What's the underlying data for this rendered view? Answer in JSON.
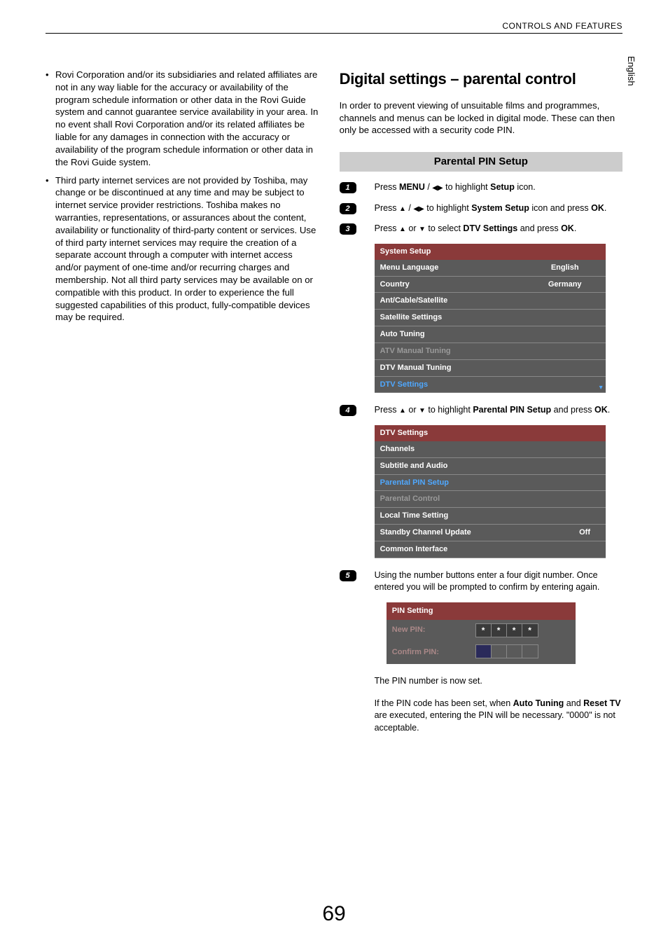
{
  "header": {
    "section": "CONTROLS AND FEATURES"
  },
  "sideTab": "English",
  "left": {
    "bullets": [
      "Rovi Corporation and/or its subsidiaries and related affiliates are not in any way liable for the accuracy or availability of the program schedule information or other data in the Rovi Guide system and cannot guarantee service availability in your area. In no event shall Rovi Corporation and/or its related affiliates be liable for any damages in connection with the accuracy or availability of the program schedule information or other data in the Rovi Guide system.",
      "Third party internet services are not provided by Toshiba, may change or be discontinued at any time and may be subject to internet service provider restrictions. Toshiba makes no warranties, representations, or assurances about the content, availability or functionality of third-party content or services. Use of third party internet services may require the creation of a separate account through a computer with internet access and/or payment of one-time and/or recurring charges and membership. Not all third party services may be available on or compatible with this product. In order to experience the full suggested capabilities of this product, fully-compatible devices may be required."
    ]
  },
  "right": {
    "title": "Digital settings – parental control",
    "intro": "In order to prevent viewing of unsuitable films and programmes, channels and menus can be locked in digital mode. These can then only be accessed with a security code PIN.",
    "subheading": "Parental PIN Setup",
    "steps": {
      "s1": {
        "n": "1",
        "a": "Press ",
        "b": "MENU",
        "c": " / ",
        "d": " to highlight ",
        "e": "Setup",
        "f": " icon."
      },
      "s2": {
        "n": "2",
        "a": "Press ",
        "b": " / ",
        "c": " to highlight ",
        "d": "System Setup",
        "e": " icon and press ",
        "f": "OK",
        "g": "."
      },
      "s3": {
        "n": "3",
        "a": "Press ",
        "b": " or ",
        "c": " to select ",
        "d": "DTV Settings",
        "e": " and press ",
        "f": "OK",
        "g": "."
      },
      "s4": {
        "n": "4",
        "a": "Press ",
        "b": " or ",
        "c": " to highlight ",
        "d": "Parental PIN Setup",
        "e": " and press ",
        "f": "OK",
        "g": "."
      },
      "s5": {
        "n": "5",
        "text": "Using the number buttons enter a four digit number. Once entered you will be prompted to confirm by entering again."
      }
    },
    "menu1": {
      "header": "System Setup",
      "rows": [
        {
          "label": "Menu Language",
          "val": "English"
        },
        {
          "label": "Country",
          "val": "Germany"
        },
        {
          "label": "Ant/Cable/Satellite",
          "val": ""
        },
        {
          "label": "Satellite Settings",
          "val": ""
        },
        {
          "label": "Auto Tuning",
          "val": ""
        },
        {
          "label": "ATV Manual Tuning",
          "val": "",
          "dim": true
        },
        {
          "label": "DTV Manual Tuning",
          "val": ""
        },
        {
          "label": "DTV Settings",
          "val": "",
          "hl": true
        }
      ]
    },
    "menu2": {
      "header": "DTV Settings",
      "rows": [
        {
          "label": "Channels",
          "val": ""
        },
        {
          "label": "Subtitle and Audio",
          "val": ""
        },
        {
          "label": "Parental PIN Setup",
          "val": "",
          "hl": true
        },
        {
          "label": "Parental Control",
          "val": "",
          "dim": true
        },
        {
          "label": "Local Time Setting",
          "val": ""
        },
        {
          "label": "Standby Channel Update",
          "val": "Off"
        },
        {
          "label": "Common Interface",
          "val": ""
        }
      ]
    },
    "pin": {
      "header": "PIN Setting",
      "newLabel": "New PIN:",
      "confirmLabel": "Confirm PIN:",
      "star": "*"
    },
    "after1": "The PIN number is now set.",
    "after2": {
      "a": "If the PIN code has been set, when ",
      "b": "Auto Tuning",
      "c": " and ",
      "d": "Reset TV",
      "e": " are executed, entering the PIN will be necessary. \"0000\" is not acceptable."
    }
  },
  "pageNum": "69"
}
